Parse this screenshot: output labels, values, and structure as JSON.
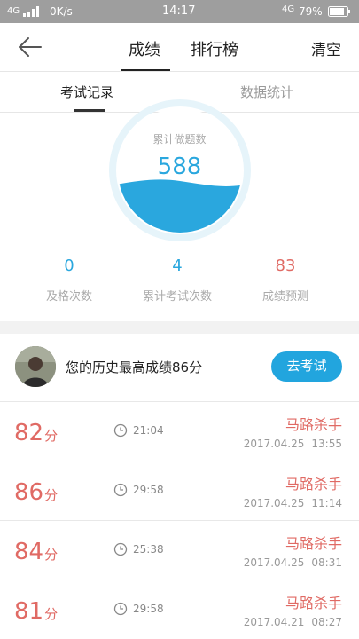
{
  "status_bar": {
    "network_left": "4G",
    "speed": "0K/s",
    "time": "14:17",
    "network_right": "4G",
    "battery": "79%"
  },
  "header": {
    "tabs": [
      {
        "label": "成绩",
        "active": true
      },
      {
        "label": "排行榜",
        "active": false
      }
    ],
    "clear_label": "清空"
  },
  "sub_tabs": [
    {
      "label": "考试记录",
      "active": true
    },
    {
      "label": "数据统计",
      "active": false
    }
  ],
  "gauge": {
    "label": "累计做题数",
    "value": "588"
  },
  "stats": [
    {
      "value": "0",
      "label": "及格次数",
      "color": "#2aa7de"
    },
    {
      "value": "4",
      "label": "累计考试次数",
      "color": "#2aa7de"
    },
    {
      "value": "83",
      "label": "成绩预测",
      "color": "#e06a64"
    }
  ],
  "best": {
    "text": "您的历史最高成绩86分",
    "button_label": "去考试"
  },
  "records": [
    {
      "score": "82",
      "unit": "分",
      "duration": "21:04",
      "name": "马路杀手",
      "date": "2017.04.25",
      "time": "13:55"
    },
    {
      "score": "86",
      "unit": "分",
      "duration": "29:58",
      "name": "马路杀手",
      "date": "2017.04.25",
      "time": "11:14"
    },
    {
      "score": "84",
      "unit": "分",
      "duration": "25:38",
      "name": "马路杀手",
      "date": "2017.04.25",
      "time": "08:31"
    },
    {
      "score": "81",
      "unit": "分",
      "duration": "29:58",
      "name": "马路杀手",
      "date": "2017.04.21",
      "time": "08:27"
    }
  ],
  "colors": {
    "accent_blue": "#2aa7de",
    "score_red": "#e06a64",
    "status_bar": "#9e9e9e"
  }
}
